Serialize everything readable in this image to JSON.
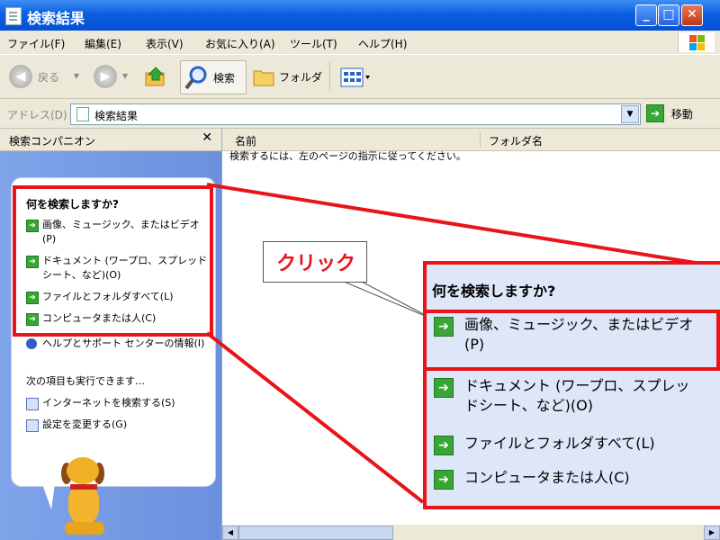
{
  "window": {
    "title": "検索結果"
  },
  "menu": [
    "ファイル(F)",
    "編集(E)",
    "表示(V)",
    "お気に入り(A)",
    "ツール(T)",
    "ヘルプ(H)"
  ],
  "toolbar": {
    "back_label": "戻る",
    "search_label": "検索",
    "folder_label": "フォルダ"
  },
  "address": {
    "label": "アドレス(D)",
    "value": "検索結果",
    "go_label": "移動"
  },
  "left_pane": {
    "title": "検索コンパニオン",
    "heading": "何を検索しますか?",
    "items": [
      "画像、ミュージック、またはビデオ(P)",
      "ドキュメント (ワープロ、スプレッドシート、など)(O)",
      "ファイルとフォルダすべて(L)",
      "コンピュータまたは人(C)",
      "ヘルプとサポート センターの情報(I)"
    ],
    "also_heading": "次の項目も実行できます…",
    "extra_items": [
      "インターネットを検索する(S)",
      "設定を変更する(G)"
    ]
  },
  "right_pane": {
    "columns": [
      "名前",
      "フォルダ名"
    ],
    "hint": "検索するには、左のページの指示に従ってください。"
  },
  "annotation": {
    "callout": "クリック",
    "zoom_heading": "何を検索しますか?",
    "zoom_items": [
      "画像、ミュージック、またはビデオ(P)",
      "ドキュメント (ワープロ、スプレッドシート、など)(O)",
      "ファイルとフォルダすべて(L)",
      "コンピュータまたは人(C)"
    ],
    "color": "#e8141a"
  },
  "icons": [
    "window-icon",
    "back-icon",
    "forward-icon",
    "up-folder-icon",
    "search-icon",
    "folder-icon",
    "views-icon",
    "go-arrow-icon",
    "xp-logo-icon",
    "dog-assistant-icon"
  ]
}
